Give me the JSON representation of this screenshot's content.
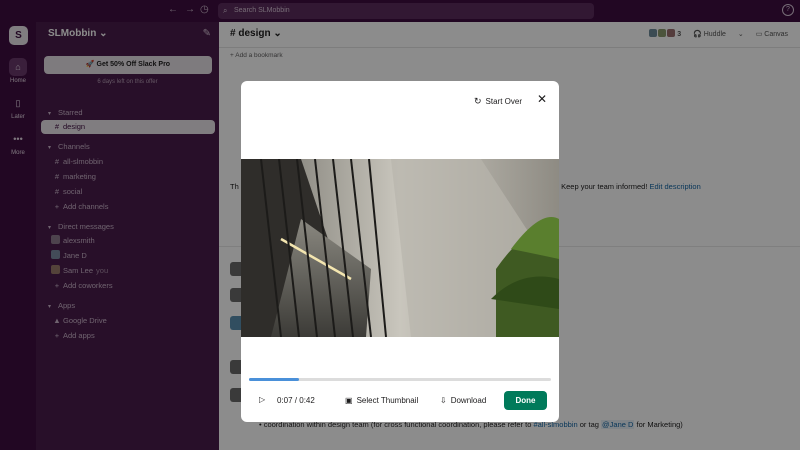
{
  "topbar": {
    "back_icon": "←",
    "forward_icon": "→",
    "history_icon": "◷",
    "search_icon": "⌕",
    "search_text": "Search SLMobbin",
    "help_icon": "?"
  },
  "rail": {
    "workspace_initial": "S",
    "items": [
      {
        "label": "Home",
        "icon": "⌂"
      },
      {
        "label": "Later",
        "icon": "▯"
      },
      {
        "label": "More",
        "icon": "•••"
      }
    ]
  },
  "sidebar": {
    "workspace_name": "SLMobbin",
    "workspace_caret": "⌄",
    "compose_icon": "✎",
    "promo_label": "🚀 Get 50% Off Slack Pro",
    "promo_note": "6 days left on this offer",
    "starred_header": "Starred",
    "starred": [
      {
        "label": "design",
        "glyph": "#"
      }
    ],
    "channels_header": "Channels",
    "channels": [
      {
        "label": "all-slmobbin",
        "glyph": "#"
      },
      {
        "label": "marketing",
        "glyph": "#"
      },
      {
        "label": "social",
        "glyph": "#"
      },
      {
        "label": "Add channels",
        "glyph": "+"
      }
    ],
    "dm_header": "Direct messages",
    "dms": [
      {
        "label": "alexsmith",
        "you": ""
      },
      {
        "label": "Jane D",
        "you": ""
      },
      {
        "label": "Sam Lee",
        "you": "you"
      }
    ],
    "add_coworkers": "Add coworkers",
    "apps_header": "Apps",
    "apps": [
      {
        "label": "Google Drive",
        "glyph": "▲"
      },
      {
        "label": "Add apps",
        "glyph": "+"
      }
    ]
  },
  "main": {
    "channel_title": "# design ⌄",
    "member_count": "3",
    "huddle_label": "🎧 Huddle",
    "canvas_label": "▭ Canvas",
    "add_bookmark": "+ Add a bookmark",
    "intro_prefix": "Th",
    "intro_text": "r. Keep your team informed!",
    "edit_description": "Edit description",
    "bullet_text": "coordination within design team (for cross functional coordination, please refer to",
    "bullet_channel": "#all-slmobbin",
    "bullet_or": "or tag",
    "bullet_mention": "@Jane D",
    "bullet_tail": "for Marketing)"
  },
  "modal": {
    "start_over": "Start Over",
    "start_over_icon": "↻",
    "close_icon": "✕",
    "play_icon": "▷",
    "time": "0:07 / 0:42",
    "progress": 0.167,
    "select_thumbnail": "Select Thumbnail",
    "thumbnail_icon": "▣",
    "download": "Download",
    "download_icon": "⇩",
    "done": "Done"
  },
  "colors": {
    "aubergine": "#3f0e40",
    "sidebar": "#4a1d4b",
    "done_green": "#007a5a",
    "progress_blue": "#4a90d9",
    "link_blue": "#1264a3"
  }
}
